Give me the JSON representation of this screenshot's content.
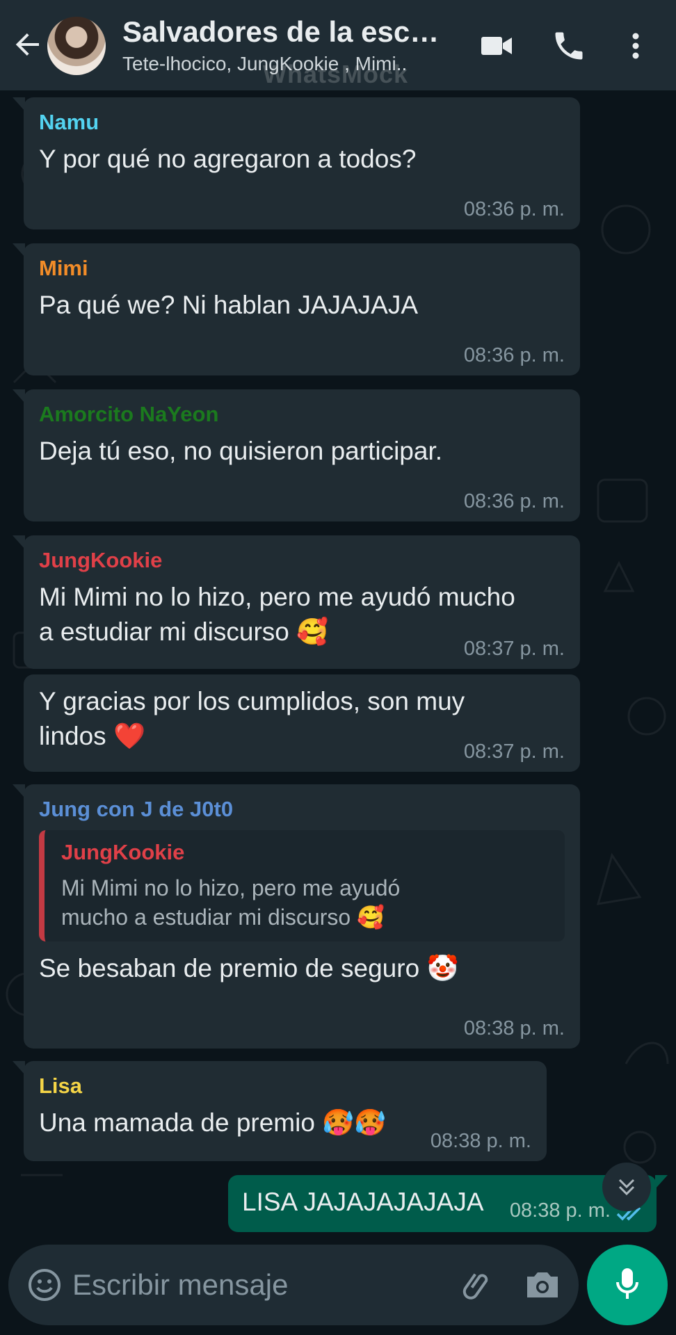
{
  "header": {
    "title": "Salvadores de la escu...",
    "subtitle": "Tete-lhocico, JungKookie , Mimi..",
    "watermark": "WhatsMock",
    "icons": [
      "back-arrow-icon",
      "video-call-icon",
      "phone-icon",
      "more-options-icon"
    ]
  },
  "colors": {
    "header_bg": "#1f2c34",
    "chat_bg": "#0b141a",
    "incoming_bubble": "#202c33",
    "outgoing_bubble": "#005c4b",
    "accent": "#00a884",
    "read_ticks": "#53bdeb"
  },
  "messages": [
    {
      "sender": "Namu",
      "sender_color": "#53d3f0",
      "text": "Y por qué no agregaron a todos?",
      "time": "08:36 p. m."
    },
    {
      "sender": "Mimi",
      "sender_color": "#f28c28",
      "text": "Pa qué we? Ni hablan JAJAJAJA",
      "time": "08:36 p. m."
    },
    {
      "sender": "Amorcito NaYeon",
      "sender_color": "#1b7a1e",
      "text": "Deja tú eso, no quisieron participar.",
      "time": "08:36 p. m."
    },
    {
      "sender": "JungKookie",
      "sender_color": "#e04048",
      "text_line1": "Mi Mimi no lo hizo, pero me ayudó mucho",
      "text_line2": "a estudiar mi discurso 🥰",
      "time": "08:37 p. m."
    },
    {
      "text_line1": "Y gracias por los cumplidos, son muy",
      "text_line2": "lindos ❤️",
      "time": "08:37 p. m."
    },
    {
      "sender": "Jung con J de J0t0",
      "sender_color": "#5b8fd6",
      "quote": {
        "sender": "JungKookie",
        "text_line1": "Mi Mimi no lo hizo, pero me ayudó",
        "text_line2": "mucho a estudiar mi discurso 🥰"
      },
      "text": "Se besaban de premio de seguro 🤡",
      "time": "08:38 p. m."
    },
    {
      "sender": "Lisa",
      "sender_color": "#f5d547",
      "text": "Una mamada de premio 🥵🥵",
      "time": "08:38 p. m."
    }
  ],
  "outgoing": {
    "text": "LISA JAJAJAJAJAJA",
    "time": "08:38 p. m.",
    "status": "read"
  },
  "input": {
    "placeholder": "Escribir mensaje",
    "value": ""
  },
  "input_icons": [
    "emoji-icon",
    "attach-icon",
    "camera-icon",
    "mic-icon"
  ],
  "scroll_icon": "double-chevron-down-icon"
}
